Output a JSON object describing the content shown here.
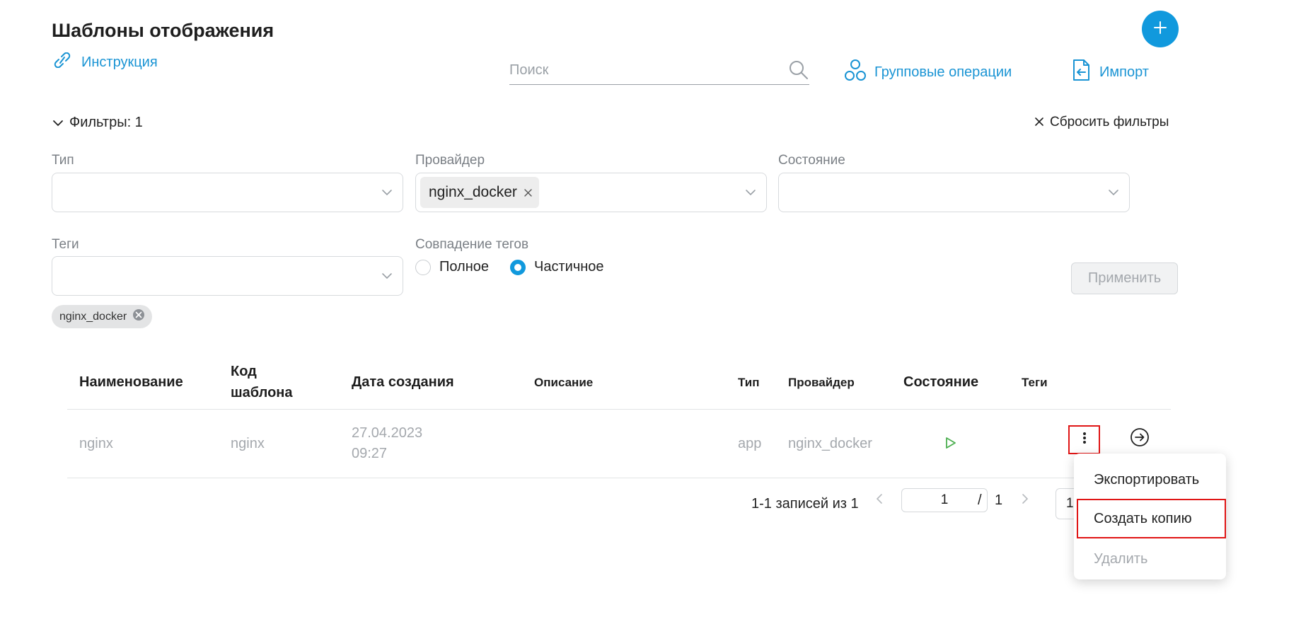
{
  "header": {
    "title": "Шаблоны отображения",
    "instruction_label": "Инструкция",
    "search_placeholder": "Поиск",
    "group_ops_label": "Групповые операции",
    "import_label": "Импорт"
  },
  "filters": {
    "toggle_label": "Фильтры: 1",
    "reset_label": "Сбросить фильтры",
    "type_label": "Тип",
    "provider_label": "Провайдер",
    "provider_value": "nginx_docker",
    "state_label": "Состояние",
    "tags_label": "Теги",
    "tag_match_label": "Совпадение тегов",
    "tag_match_options": [
      "Полное",
      "Частичное"
    ],
    "tag_match_selected": "Частичное",
    "apply_label": "Применить",
    "active_tag": "nginx_docker"
  },
  "table": {
    "columns": {
      "name": "Наименование",
      "code_line1": "Код",
      "code_line2": "шаблона",
      "created": "Дата создания",
      "description": "Описание",
      "type": "Тип",
      "provider": "Провайдер",
      "state": "Состояние",
      "tags": "Теги"
    },
    "rows": [
      {
        "name": "nginx",
        "code": "nginx",
        "date": "27.04.2023",
        "time": "09:27",
        "description": "",
        "type": "app",
        "provider": "nginx_docker",
        "state_icon": "play-icon",
        "tags": ""
      }
    ]
  },
  "pager": {
    "summary": "1-1 записей из 1",
    "current_page": "1",
    "separator": "/",
    "total_pages": "1",
    "page_size_partial": "1"
  },
  "context_menu": {
    "items": [
      "Экспортировать",
      "Создать копию",
      "Удалить"
    ]
  },
  "colors": {
    "accent": "#1199dd",
    "highlight": "#e01515",
    "play": "#4caf50"
  }
}
